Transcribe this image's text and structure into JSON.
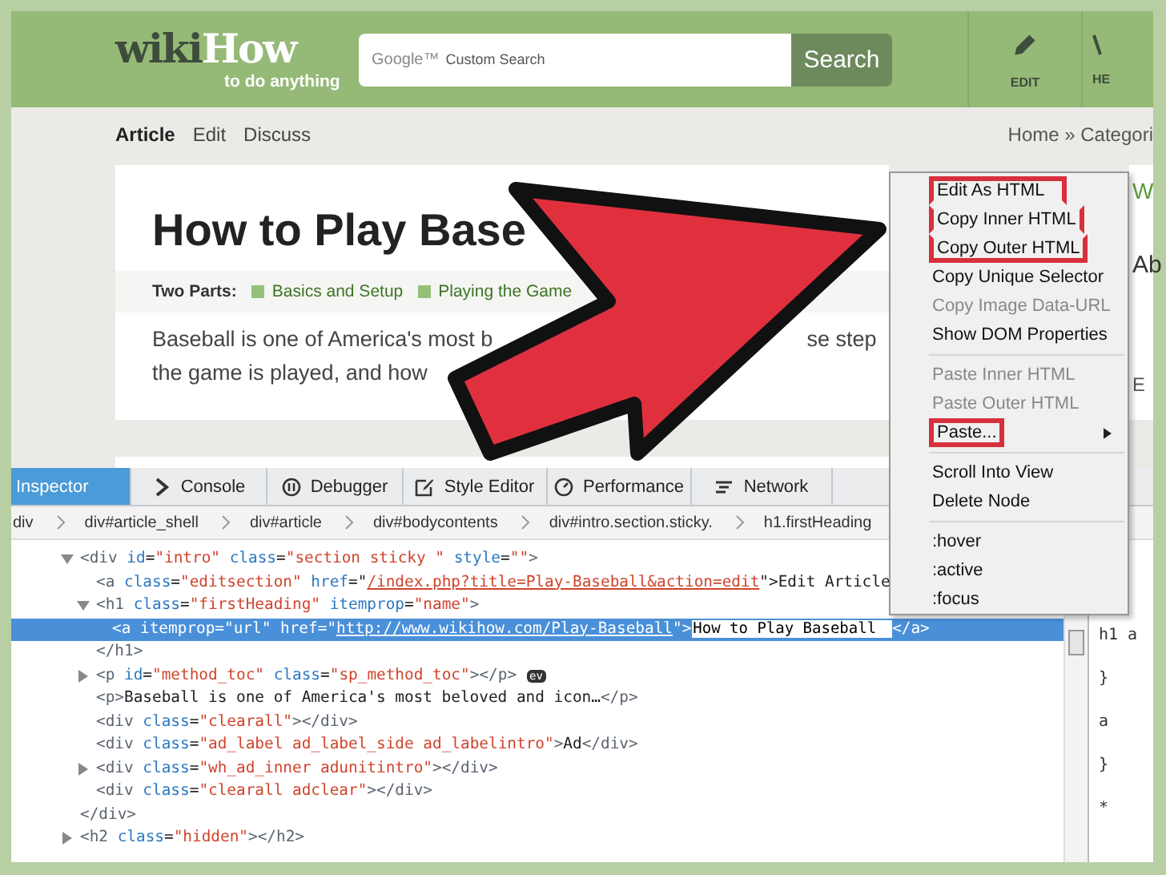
{
  "header": {
    "logo_main": "wiki",
    "logo_accent": "How",
    "tagline": "to do anything",
    "search": {
      "brand": "Google™",
      "placeholder": "Custom Search"
    },
    "search_button": "Search",
    "actions": [
      {
        "label": "EDIT"
      },
      {
        "label": "HE"
      }
    ]
  },
  "nav": {
    "tabs": [
      {
        "label": "Article",
        "selected": true
      },
      {
        "label": "Edit",
        "selected": false
      },
      {
        "label": "Discuss",
        "selected": false
      }
    ],
    "breadcrumb": "Home » Categori"
  },
  "article": {
    "title": "How to Play Base",
    "parts_label": "Two Parts:",
    "parts": [
      "Basics and Setup",
      "Playing the Game"
    ],
    "intro_fragments": [
      "Baseball is one of America's most b",
      "se step",
      "the game is played, and how"
    ]
  },
  "sidebar": {
    "texts": [
      "W",
      "Ab",
      "E"
    ]
  },
  "devtools": {
    "tabs": [
      {
        "label": "Inspector",
        "selected": true
      },
      {
        "label": "Console",
        "selected": false
      },
      {
        "label": "Debugger",
        "selected": false
      },
      {
        "label": "Style Editor",
        "selected": false
      },
      {
        "label": "Performance",
        "selected": false
      },
      {
        "label": "Network",
        "selected": false
      }
    ],
    "breadcrumb": [
      "div",
      "div#article_shell",
      "div#article",
      "div#bodycontents",
      "div#intro.section.sticky.",
      "h1.firstHeading"
    ],
    "tree": [
      {
        "selected": false,
        "expanded": true,
        "tokens": [
          {
            "kind": "tag",
            "text": "<div"
          },
          {
            "kind": "attr",
            "text": " id"
          },
          {
            "kind": "text",
            "text": "="
          },
          {
            "kind": "value",
            "text": "\"intro\""
          },
          {
            "kind": "attr",
            "text": " class"
          },
          {
            "kind": "text",
            "text": "="
          },
          {
            "kind": "value",
            "text": "\"section sticky \""
          },
          {
            "kind": "attr",
            "text": " style"
          },
          {
            "kind": "text",
            "text": "="
          },
          {
            "kind": "value",
            "text": "\"\""
          },
          {
            "kind": "tag",
            "text": ">"
          }
        ],
        "children": [
          {
            "selected": false,
            "tokens": [
              {
                "kind": "tag",
                "text": "<a"
              },
              {
                "kind": "attr",
                "text": " class"
              },
              {
                "kind": "text",
                "text": "="
              },
              {
                "kind": "value",
                "text": "\"editsection\""
              },
              {
                "kind": "attr",
                "text": " href"
              },
              {
                "kind": "text",
                "text": "=\""
              },
              {
                "kind": "link",
                "text": "/index.php?title=Play-Baseball&action=edit"
              },
              {
                "kind": "text",
                "text": "\">Edit Article"
              }
            ]
          },
          {
            "selected": false,
            "expanded": true,
            "tokens": [
              {
                "kind": "tag",
                "text": "<h1"
              },
              {
                "kind": "attr",
                "text": " class"
              },
              {
                "kind": "text",
                "text": "="
              },
              {
                "kind": "value",
                "text": "\"firstHeading\""
              },
              {
                "kind": "attr",
                "text": " itemprop"
              },
              {
                "kind": "text",
                "text": "="
              },
              {
                "kind": "value",
                "text": "\"name\""
              },
              {
                "kind": "tag",
                "text": ">"
              }
            ],
            "children": [
              {
                "selected": true,
                "tokens": [
                  {
                    "kind": "tag",
                    "text": "<a"
                  },
                  {
                    "kind": "attr",
                    "text": " itemprop"
                  },
                  {
                    "kind": "text",
                    "text": "="
                  },
                  {
                    "kind": "value",
                    "text": "\"url\""
                  },
                  {
                    "kind": "attr",
                    "text": " href"
                  },
                  {
                    "kind": "text",
                    "text": "=\""
                  },
                  {
                    "kind": "link",
                    "text": "http://www.wikihow.com/Play-Baseball"
                  },
                  {
                    "kind": "text",
                    "text": "\">"
                  },
                  {
                    "kind": "editbox",
                    "text": "How to Play Baseball"
                  },
                  {
                    "kind": "tag",
                    "text": "</a>"
                  }
                ]
              }
            ],
            "closing": [
              {
                "kind": "tag",
                "text": "</h1>"
              }
            ]
          },
          {
            "selected": false,
            "expanded": false,
            "tokens": [
              {
                "kind": "tag",
                "text": "<p"
              },
              {
                "kind": "attr",
                "text": " id"
              },
              {
                "kind": "text",
                "text": "="
              },
              {
                "kind": "value",
                "text": "\"method_toc\""
              },
              {
                "kind": "attr",
                "text": " class"
              },
              {
                "kind": "text",
                "text": "="
              },
              {
                "kind": "value",
                "text": "\"sp_method_toc\""
              },
              {
                "kind": "tag",
                "text": "></p>"
              },
              {
                "kind": "badge",
                "text": "ev"
              }
            ]
          },
          {
            "selected": false,
            "tokens": [
              {
                "kind": "tag",
                "text": "<p>"
              },
              {
                "kind": "text",
                "text": "Baseball is one of America's most beloved and icon…"
              },
              {
                "kind": "tag",
                "text": "</p>"
              }
            ]
          },
          {
            "selected": false,
            "tokens": [
              {
                "kind": "tag",
                "text": "<div"
              },
              {
                "kind": "attr",
                "text": " class"
              },
              {
                "kind": "text",
                "text": "="
              },
              {
                "kind": "value",
                "text": "\"clearall\""
              },
              {
                "kind": "tag",
                "text": "></div>"
              }
            ]
          },
          {
            "selected": false,
            "tokens": [
              {
                "kind": "tag",
                "text": "<div"
              },
              {
                "kind": "attr",
                "text": " class"
              },
              {
                "kind": "text",
                "text": "="
              },
              {
                "kind": "value",
                "text": "\"ad_label ad_label_side ad_labelintro\""
              },
              {
                "kind": "tag",
                "text": ">"
              },
              {
                "kind": "text",
                "text": "Ad"
              },
              {
                "kind": "tag",
                "text": "</div>"
              }
            ]
          },
          {
            "selected": false,
            "expanded": false,
            "tokens": [
              {
                "kind": "tag",
                "text": "<div"
              },
              {
                "kind": "attr",
                "text": " class"
              },
              {
                "kind": "text",
                "text": "="
              },
              {
                "kind": "value",
                "text": "\"wh_ad_inner adunitintro\""
              },
              {
                "kind": "tag",
                "text": "></div>"
              }
            ]
          },
          {
            "selected": false,
            "tokens": [
              {
                "kind": "tag",
                "text": "<div"
              },
              {
                "kind": "attr",
                "text": " class"
              },
              {
                "kind": "text",
                "text": "="
              },
              {
                "kind": "value",
                "text": "\"clearall adclear\""
              },
              {
                "kind": "tag",
                "text": "></div>"
              }
            ]
          }
        ],
        "closing": [
          {
            "kind": "tag",
            "text": "</div>"
          }
        ]
      },
      {
        "selected": false,
        "expanded": false,
        "tokens": [
          {
            "kind": "tag",
            "text": "<h2"
          },
          {
            "kind": "attr",
            "text": " class"
          },
          {
            "kind": "text",
            "text": "="
          },
          {
            "kind": "value",
            "text": "\"hidden\""
          },
          {
            "kind": "tag",
            "text": "></h2>"
          }
        ]
      }
    ],
    "rules": [
      "h1 a",
      "}",
      "a",
      "}",
      "*"
    ],
    "menu": [
      [
        {
          "label": "Edit As HTML",
          "disabled": false,
          "highlighted": true,
          "submenu": false
        },
        {
          "label": "Copy Inner HTML",
          "disabled": false,
          "highlighted": true,
          "submenu": false
        },
        {
          "label": "Copy Outer HTML",
          "disabled": false,
          "highlighted": true,
          "submenu": false
        },
        {
          "label": "Copy Unique Selector",
          "disabled": false,
          "highlighted": false,
          "submenu": false
        },
        {
          "label": "Copy Image Data-URL",
          "disabled": true,
          "highlighted": false,
          "submenu": false
        },
        {
          "label": "Show DOM Properties",
          "disabled": false,
          "highlighted": false,
          "submenu": false
        }
      ],
      [
        {
          "label": "Paste Inner HTML",
          "disabled": true,
          "highlighted": false,
          "submenu": false
        },
        {
          "label": "Paste Outer HTML",
          "disabled": true,
          "highlighted": false,
          "submenu": false
        },
        {
          "label": "Paste...",
          "disabled": false,
          "highlighted": true,
          "submenu": true
        }
      ],
      [
        {
          "label": "Scroll Into View",
          "disabled": false,
          "highlighted": false,
          "submenu": false
        },
        {
          "label": "Delete Node",
          "disabled": false,
          "highlighted": false,
          "submenu": false
        }
      ],
      [
        {
          "label": ":hover",
          "disabled": false,
          "highlighted": false,
          "submenu": false
        },
        {
          "label": ":active",
          "disabled": false,
          "highlighted": false,
          "submenu": false
        },
        {
          "label": ":focus",
          "disabled": false,
          "highlighted": false,
          "submenu": false
        }
      ]
    ]
  }
}
